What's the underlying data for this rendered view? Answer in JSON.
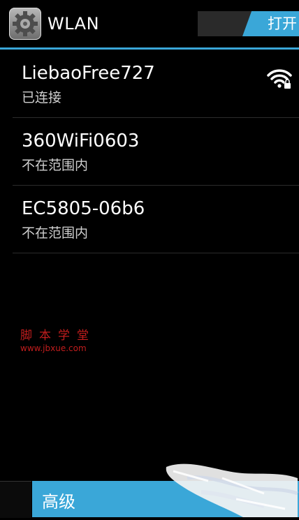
{
  "header": {
    "title": "WLAN",
    "toggle_label": "打开"
  },
  "networks": [
    {
      "name": "LiebaoFree727",
      "status": "已连接",
      "signal_icon": "wifi-locked-icon"
    },
    {
      "name": "360WiFi0603",
      "status": "不在范围内"
    },
    {
      "name": "EC5805-06b6",
      "status": "不在范围内"
    }
  ],
  "watermark": {
    "cn": "脚本学堂",
    "url": "www.jbxue.com"
  },
  "bottom": {
    "label": "高级"
  },
  "colors": {
    "accent": "#3aa7d8",
    "background": "#000000",
    "watermark": "#c21d1d"
  }
}
